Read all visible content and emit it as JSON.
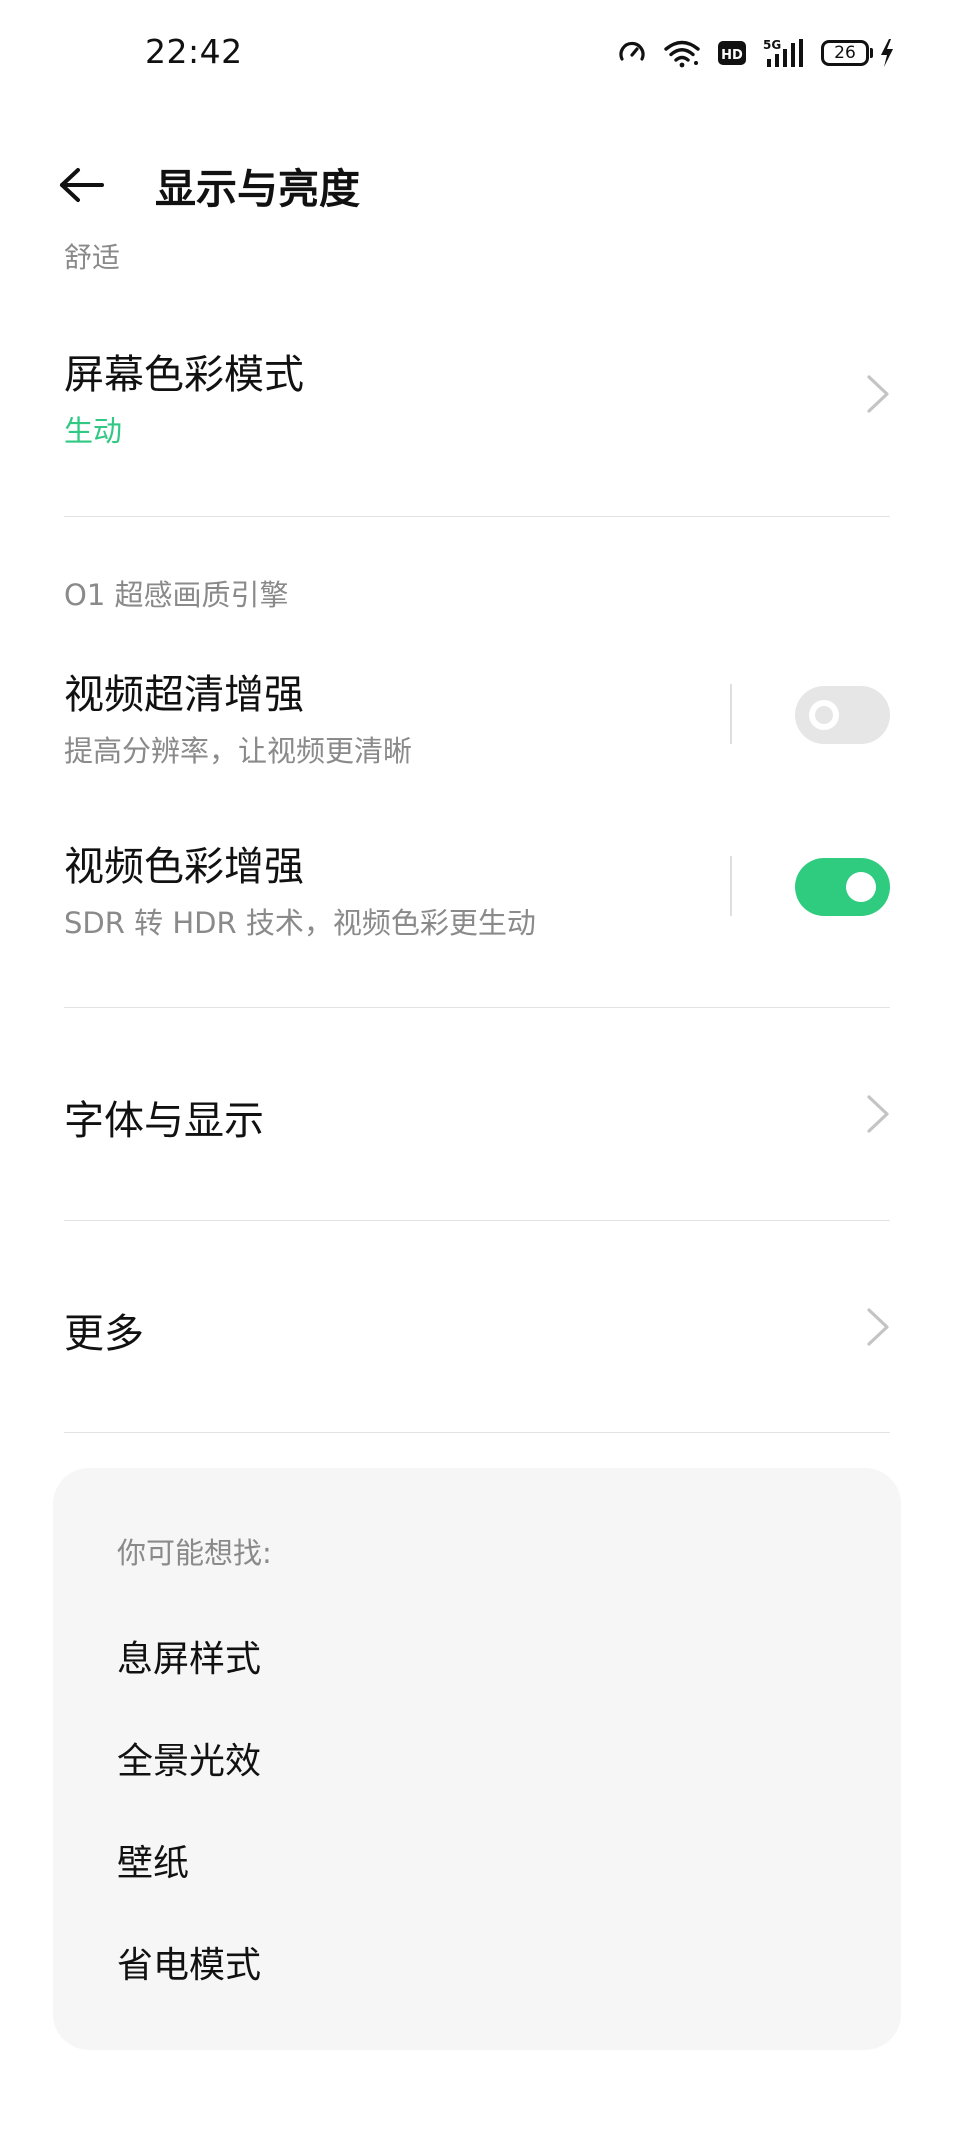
{
  "status_bar": {
    "time": "22:42",
    "network": "5G",
    "hd_badge": "HD",
    "battery": "26",
    "icons": [
      "speed-meter-icon",
      "wifi-icon",
      "hd-icon",
      "5g-signal-icon",
      "battery-icon",
      "charging-icon"
    ]
  },
  "header": {
    "back_icon": "arrow-left-icon",
    "title": "显示与亮度"
  },
  "partial_item": {
    "title": "舒适"
  },
  "color_mode": {
    "title": "屏幕色彩模式",
    "value": "生动"
  },
  "section": {
    "title": "O1 超感画质引擎"
  },
  "video_hd": {
    "title": "视频超清增强",
    "subtitle": "提高分辨率，让视频更清晰",
    "enabled": false
  },
  "video_color": {
    "title": "视频色彩增强",
    "subtitle": "SDR 转 HDR 技术，视频色彩更生动",
    "enabled": true
  },
  "font_display": {
    "title": "字体与显示"
  },
  "more": {
    "title": "更多"
  },
  "suggestions": {
    "title": "你可能想找:",
    "items": [
      "息屏样式",
      "全景光效",
      "壁纸",
      "省电模式"
    ]
  },
  "colors": {
    "accent": "#2fc983",
    "toggle_on": "#2fcc80",
    "toggle_off": "#e6e6e6",
    "secondary_text": "#8a8a8a"
  }
}
